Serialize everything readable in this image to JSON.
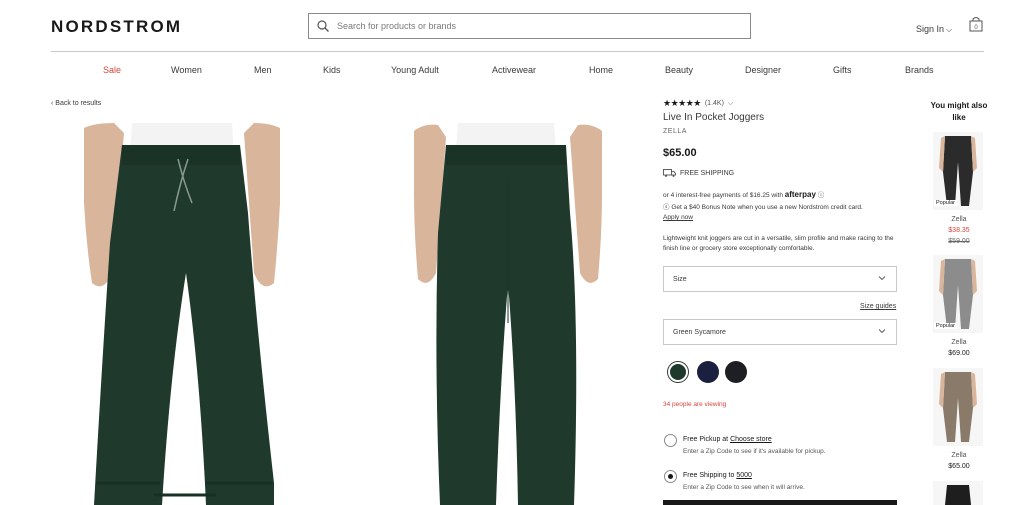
{
  "header": {
    "logo": "NORDSTROM",
    "search_placeholder": "Search for products or brands",
    "sign_in": "Sign In",
    "bag_count": "0"
  },
  "nav": [
    "Sale",
    "Women",
    "Men",
    "Kids",
    "Young Adult",
    "Activewear",
    "Home",
    "Beauty",
    "Designer",
    "Gifts",
    "Brands"
  ],
  "back_link": "Back to results",
  "product": {
    "rating_count": "(1.4K)",
    "title": "Live In Pocket Joggers",
    "brand": "ZELLA",
    "price": "$65.00",
    "free_shipping": "FREE SHIPPING",
    "afterpay_text": "or 4 interest-free payments of $16.25 with",
    "afterpay_brand": "afterpay",
    "bonus_text": "Get a $40 Bonus Note when you use a new Nordstrom credit card.",
    "apply_now": "Apply now",
    "description": "Lightweight knit joggers are cut in a versatile, slim profile and make racing to the finish line or grocery store exceptionally comfortable.",
    "size_label": "Size",
    "size_guides": "Size guides",
    "color_selected": "Green Sycamore",
    "viewing": "34 people are viewing",
    "pickup_title_prefix": "Free Pickup at",
    "pickup_link": "Choose store",
    "pickup_sub": "Enter a Zip Code to see if it's available for pickup.",
    "shipping_title_prefix": "Free Shipping to",
    "shipping_zip": "5000",
    "shipping_sub": "Enter a Zip Code to see when it will arrive."
  },
  "colors": {
    "sale_red": "#d6453d",
    "swatches": [
      "#1f3a2c",
      "#1b2040",
      "#1e1f22"
    ]
  },
  "recommendations": {
    "heading": "You might also like",
    "items": [
      {
        "badge": "Popular",
        "name": "Zella",
        "price": "$38.35",
        "original_price": "$59.00"
      },
      {
        "badge": "Popular",
        "name": "Zella",
        "price": "$69.00"
      },
      {
        "name": "Zella",
        "price": "$65.00"
      }
    ]
  }
}
